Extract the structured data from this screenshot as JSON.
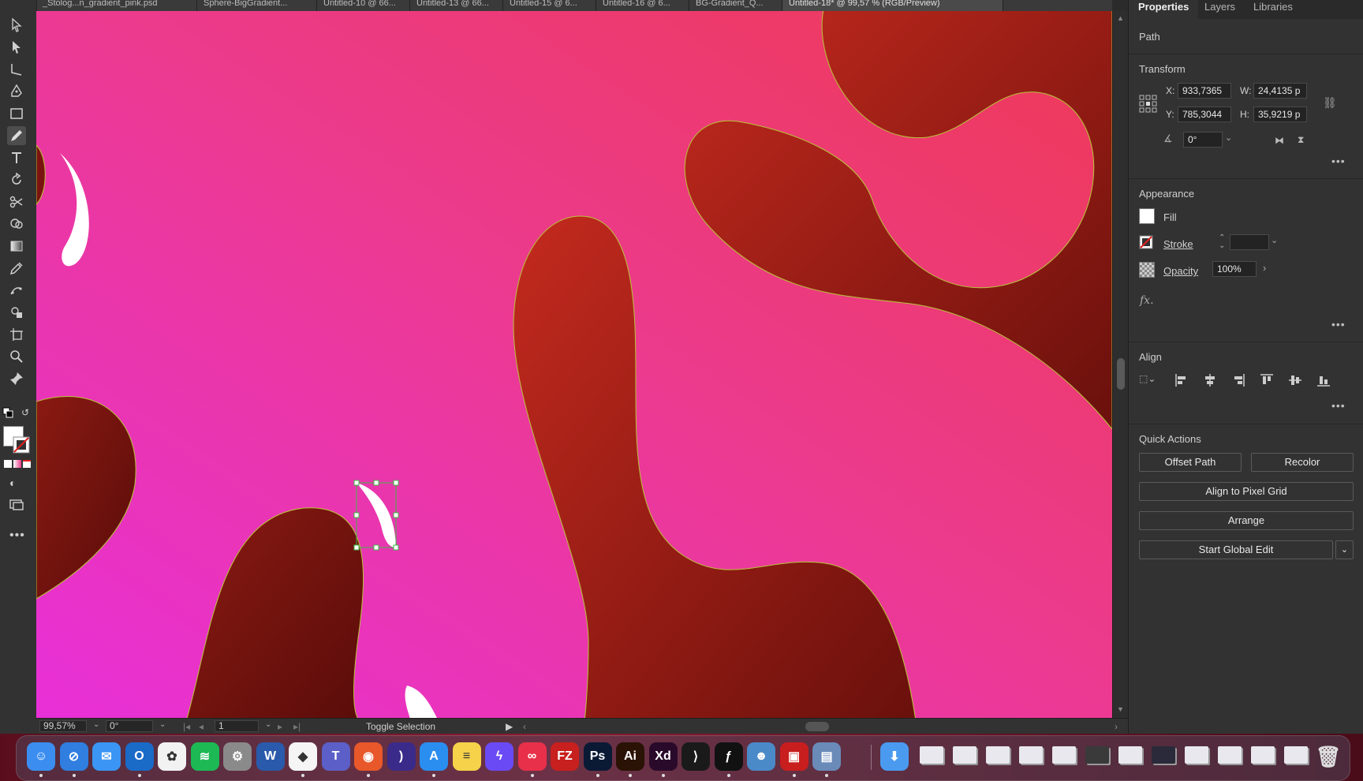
{
  "document_tabs": [
    {
      "label": "_Stolog...n_gradient_pink.psd"
    },
    {
      "label": "Sphere-BigGradient..."
    },
    {
      "label": "Untitled-10 @ 66..."
    },
    {
      "label": "Untitled-13 @ 66..."
    },
    {
      "label": "Untitled-15 @ 6..."
    },
    {
      "label": "Untitled-16 @ 6..."
    },
    {
      "label": "BG-Gradient_Q..."
    },
    {
      "label": "Untitled-18* @ 99,57 % (RGB/Preview)"
    }
  ],
  "tools": [
    {
      "name": "selection-tool-icon"
    },
    {
      "name": "direct-selection-tool-icon"
    },
    {
      "name": "line-segment-tool-icon"
    },
    {
      "name": "pen-tool-icon"
    },
    {
      "name": "rectangle-tool-icon"
    },
    {
      "name": "pencil-tool-icon"
    },
    {
      "name": "type-tool-icon"
    },
    {
      "name": "rotate-tool-icon"
    },
    {
      "name": "scissors-tool-icon"
    },
    {
      "name": "shape-builder-tool-icon"
    },
    {
      "name": "gradient-tool-icon"
    },
    {
      "name": "eyedropper-tool-icon"
    },
    {
      "name": "puppet-warp-tool-icon"
    },
    {
      "name": "symbol-sprayer-tool-icon"
    },
    {
      "name": "artboard-tool-icon"
    },
    {
      "name": "zoom-tool-icon"
    },
    {
      "name": "pin-tool-icon"
    }
  ],
  "statusbar": {
    "zoom": "99,57%",
    "rotation": "0°",
    "artboard": "1",
    "status_text": "Toggle Selection"
  },
  "panel": {
    "tabs": [
      "Properties",
      "Layers",
      "Libraries"
    ],
    "active_tab": "Properties",
    "object_type": "Path",
    "transform": {
      "title": "Transform",
      "x_label": "X:",
      "x": "933,7365",
      "y_label": "Y:",
      "y": "785,3044",
      "w_label": "W:",
      "w": "24,4135 p",
      "h_label": "H:",
      "h": "35,9219 p",
      "angle": "0°"
    },
    "appearance": {
      "title": "Appearance",
      "fill_label": "Fill",
      "stroke_label": "Stroke",
      "opacity_label": "Opacity",
      "opacity": "100%",
      "fx_label": "fx."
    },
    "align": {
      "title": "Align"
    },
    "quick_actions": {
      "title": "Quick Actions",
      "offset_path": "Offset Path",
      "recolor": "Recolor",
      "align_pixel_grid": "Align to Pixel Grid",
      "arrange": "Arrange",
      "start_global_edit": "Start Global Edit"
    }
  },
  "colors": {
    "canvas_gradient_start": "#e830d8",
    "canvas_gradient_end": "#ee3a54",
    "blob_dark": "#7a1410",
    "blob_light": "#c42a1e",
    "selection": "#3fb84a",
    "panel_bg": "#323232"
  },
  "dock_apps": [
    {
      "name": "finder-icon",
      "color": "#3b8ef0",
      "glyph": "☺"
    },
    {
      "name": "safari-icon",
      "color": "#2f7ee0",
      "glyph": "⊘"
    },
    {
      "name": "mail-icon",
      "color": "#3a95f4",
      "glyph": "✉"
    },
    {
      "name": "outlook-icon",
      "color": "#1a6ac8",
      "glyph": "O"
    },
    {
      "name": "photos-icon",
      "color": "#f2f2f2",
      "glyph": "✿"
    },
    {
      "name": "spotify-icon",
      "color": "#1db954",
      "glyph": "≋"
    },
    {
      "name": "system-preferences-icon",
      "color": "#8a8a8a",
      "glyph": "⚙"
    },
    {
      "name": "word-icon",
      "color": "#2a5aab",
      "glyph": "W"
    },
    {
      "name": "sketch-icon",
      "color": "#f5f5f5",
      "glyph": "◆"
    },
    {
      "name": "teams-icon",
      "color": "#5b5fc7",
      "glyph": "T"
    },
    {
      "name": "firefox-icon",
      "color": "#e8582a",
      "glyph": "◉"
    },
    {
      "name": "podcast-icon",
      "color": "#3a2a8a",
      "glyph": ")"
    },
    {
      "name": "app-store-icon",
      "color": "#2a8ef0",
      "glyph": "A"
    },
    {
      "name": "notes-icon",
      "color": "#f5d24a",
      "glyph": "≡"
    },
    {
      "name": "messenger-icon",
      "color": "#6a4af5",
      "glyph": "ϟ"
    },
    {
      "name": "creative-cloud-icon",
      "color": "#e8304a",
      "glyph": "∞"
    },
    {
      "name": "filezilla-icon",
      "color": "#c8201e",
      "glyph": "FZ"
    },
    {
      "name": "photoshop-icon",
      "color": "#0a1a35",
      "glyph": "Ps"
    },
    {
      "name": "illustrator-icon",
      "color": "#2a1205",
      "glyph": "Ai"
    },
    {
      "name": "xd-icon",
      "color": "#2a0a2a",
      "glyph": "Xd"
    },
    {
      "name": "vscode-icon",
      "color": "#1a1a1a",
      "glyph": "⟩"
    },
    {
      "name": "script-icon",
      "color": "#111111",
      "glyph": "ƒ"
    },
    {
      "name": "avatar-app-icon",
      "color": "#4a8ac8",
      "glyph": "☻"
    },
    {
      "name": "pdf-app-icon",
      "color": "#c81e1e",
      "glyph": "▣"
    },
    {
      "name": "preview-icon",
      "color": "#6a8ab8",
      "glyph": "▤"
    }
  ]
}
